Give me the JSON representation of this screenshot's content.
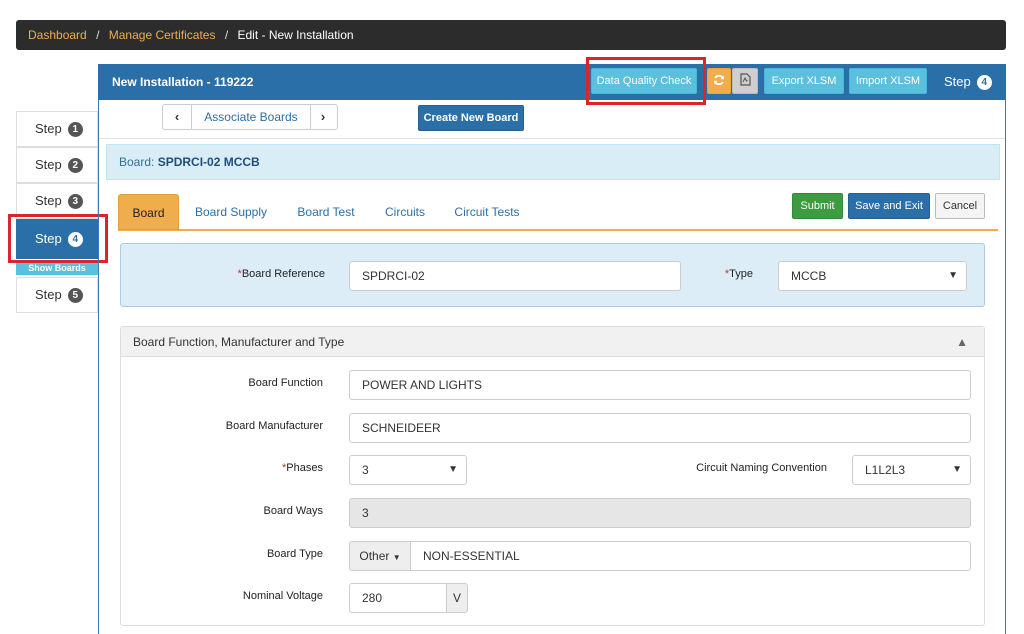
{
  "breadcrumb": {
    "items": [
      "Dashboard",
      "Manage Certificates"
    ],
    "separator": "/",
    "current": "Edit - New Installation"
  },
  "steps": [
    {
      "label": "Step",
      "number": "1",
      "active": false
    },
    {
      "label": "Step",
      "number": "2",
      "active": false
    },
    {
      "label": "Step",
      "number": "3",
      "active": false
    },
    {
      "label": "Step",
      "number": "4",
      "active": true
    },
    {
      "label": "Step",
      "number": "5",
      "active": false
    }
  ],
  "sidebar": {
    "show_boards": "Show Boards"
  },
  "header": {
    "title_prefix": "New Installation - ",
    "title_id": "119222",
    "data_quality_check": "Data Quality Check",
    "refresh_icon": "refresh-icon",
    "pdf_icon": "pdf-icon",
    "export_xlsm": "Export XLSM",
    "import_xlsm": "Import XLSM",
    "step_label": "Step",
    "step_number": "4"
  },
  "toolbar": {
    "prev_icon": "‹",
    "associate_boards": "Associate Boards",
    "next_icon": "›",
    "create_new_board": "Create New Board"
  },
  "board_bar": {
    "prefix": "Board: ",
    "name": "SPDRCI-02 MCCB"
  },
  "tabs": [
    {
      "label": "Board",
      "active": true
    },
    {
      "label": "Board Supply",
      "active": false
    },
    {
      "label": "Board Test",
      "active": false
    },
    {
      "label": "Circuits",
      "active": false
    },
    {
      "label": "Circuit Tests",
      "active": false
    }
  ],
  "actions": {
    "submit": "Submit",
    "save_and_exit": "Save and Exit",
    "cancel": "Cancel"
  },
  "reference": {
    "board_reference_label": "Board Reference",
    "board_reference_value": "SPDRCI-02",
    "type_label": "Type",
    "type_value": "MCCB",
    "required_marker": "*"
  },
  "section": {
    "title": "Board Function, Manufacturer and Type",
    "fields": {
      "board_function_label": "Board Function",
      "board_function_value": "POWER AND LIGHTS",
      "board_manufacturer_label": "Board Manufacturer",
      "board_manufacturer_value": "SCHNEIDEER",
      "phases_label": "Phases",
      "phases_value": "3",
      "circuit_naming_label": "Circuit Naming Convention",
      "circuit_naming_value": "L1L2L3",
      "board_ways_label": "Board Ways",
      "board_ways_value": "3",
      "board_type_label": "Board Type",
      "board_type_dropdown": "Other",
      "board_type_value": "NON-ESSENTIAL",
      "nominal_voltage_label": "Nominal Voltage",
      "nominal_voltage_value": "280",
      "nominal_voltage_unit": "V"
    }
  },
  "colors": {
    "primary": "#2a6fa8",
    "info": "#5bc0de",
    "warning": "#f0ad4e",
    "success": "#3d9b41",
    "highlight": "#d9262c",
    "breadcrumb_bg": "#2c2c2c"
  }
}
